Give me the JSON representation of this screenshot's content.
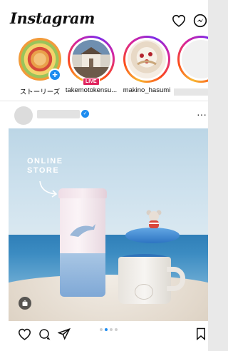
{
  "header": {
    "logo_text": "Instagram",
    "icons": [
      "heart-icon",
      "messenger-icon"
    ]
  },
  "stories": [
    {
      "label": "ストーリーズ",
      "kind": "own",
      "badge": "+"
    },
    {
      "label": "takemotokensu...",
      "kind": "live",
      "badge": "LIVE"
    },
    {
      "label": "makino_hasumi",
      "kind": "normal"
    },
    {
      "label": "",
      "kind": "normal"
    }
  ],
  "post": {
    "image_text": {
      "line1": "ONLINE",
      "line2": "STORE"
    },
    "carousel": {
      "total": 4,
      "active": 2
    },
    "icons": [
      "more-icon",
      "heart-icon",
      "comment-icon",
      "share-icon",
      "bookmark-icon"
    ],
    "more_label": "···"
  },
  "colors": {
    "accent": "#1d8cf0",
    "live": "#e0245e",
    "sea": "#2f7fb8",
    "lid": "#2d74c2"
  }
}
